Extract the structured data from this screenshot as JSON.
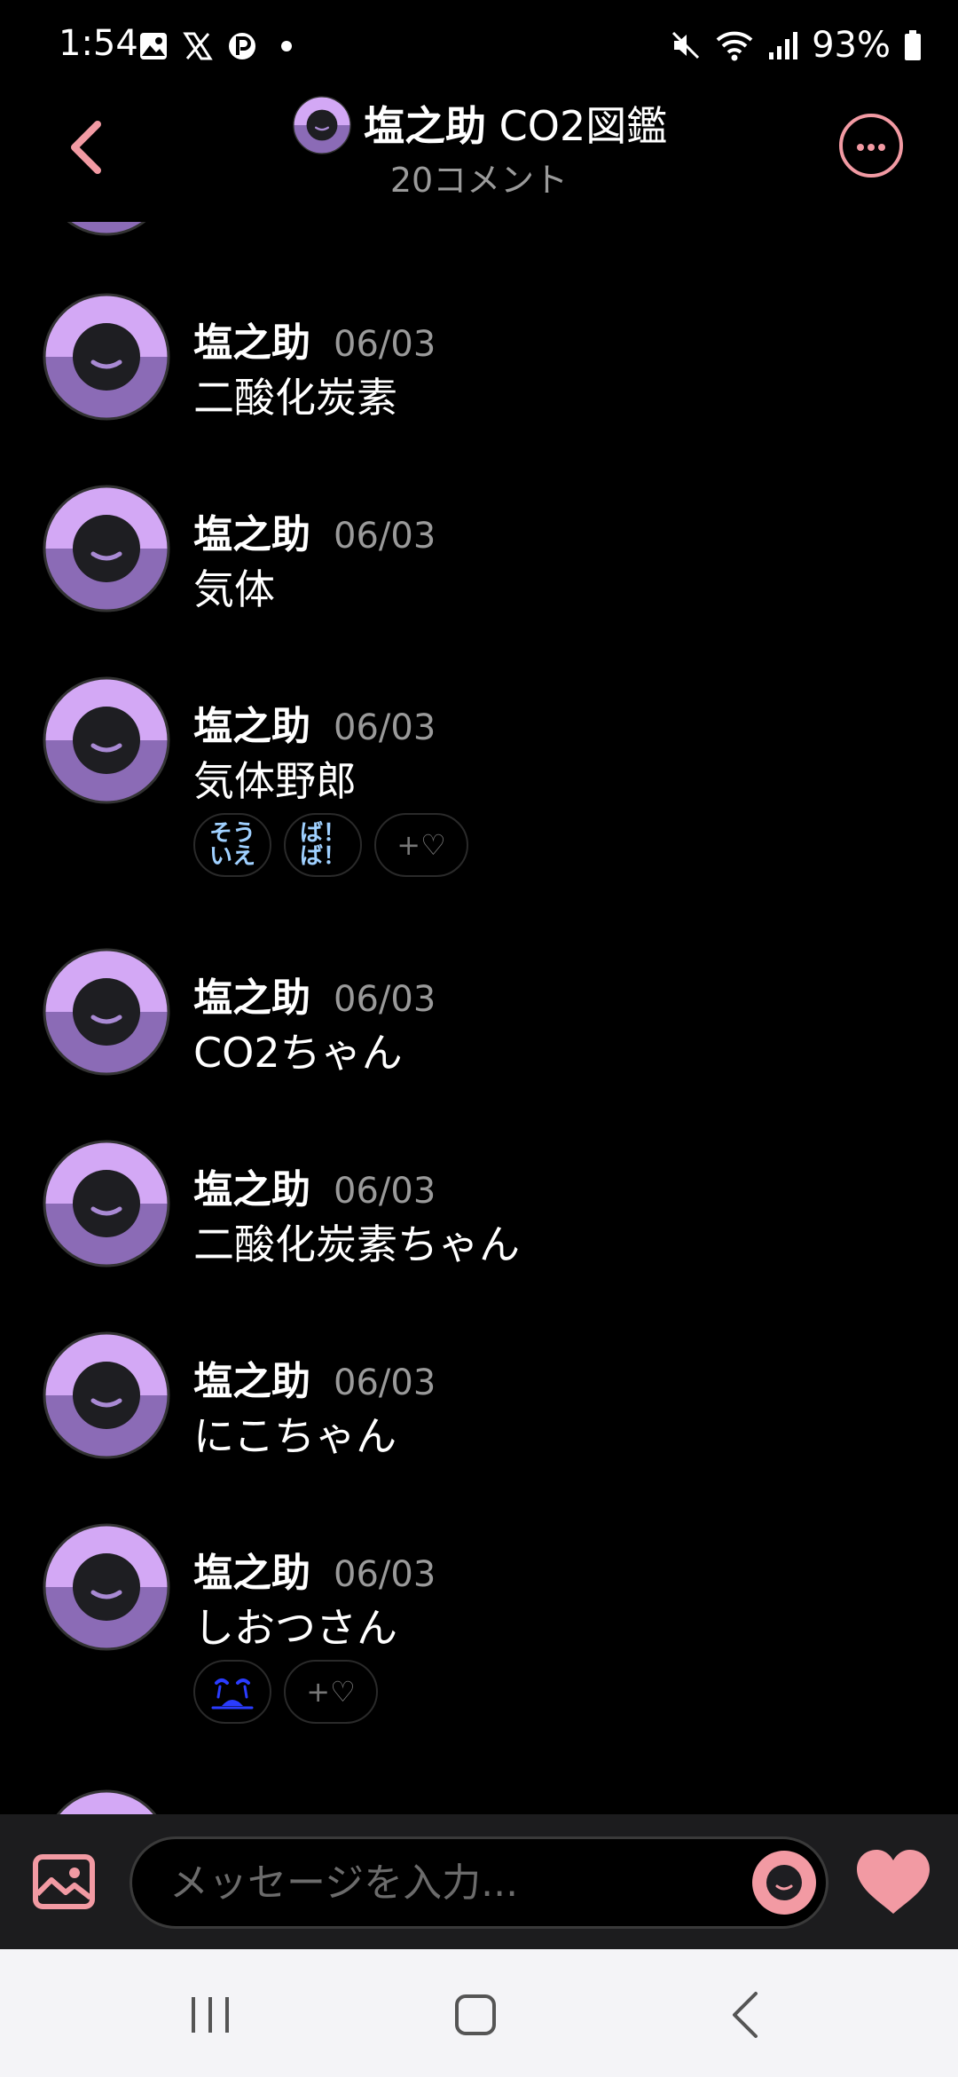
{
  "status_bar": {
    "time": "1:54",
    "battery": "93%"
  },
  "header": {
    "title_name": "塩之助",
    "title_rest": " CO2図鑑",
    "subtitle": "20コメント"
  },
  "messages": [
    {
      "name": "塩之助",
      "date": "06/03",
      "text": "二酸化炭素"
    },
    {
      "name": "塩之助",
      "date": "06/03",
      "text": "気体"
    },
    {
      "name": "塩之助",
      "date": "06/03",
      "text": "気体野郎",
      "reactions": [
        {
          "line1": "そう",
          "line2": "いえ"
        },
        {
          "line1": "ば！",
          "line2": "ば！"
        }
      ],
      "add_label": "+♡"
    },
    {
      "name": "塩之助",
      "date": "06/03",
      "text": "CO2ちゃん"
    },
    {
      "name": "塩之助",
      "date": "06/03",
      "text": "二酸化炭素ちゃん"
    },
    {
      "name": "塩之助",
      "date": "06/03",
      "text": "にこちゃん"
    },
    {
      "name": "塩之助",
      "date": "06/03",
      "text": "しおつさん",
      "add_label": "+♡"
    }
  ],
  "input": {
    "placeholder": "メッセージを入力..."
  },
  "icons": {
    "status_left": [
      "gallery-icon",
      "x-logo-icon",
      "p-icon",
      "dot-icon"
    ],
    "status_right": [
      "mute-icon",
      "wifi-icon",
      "signal-icon",
      "battery-icon"
    ],
    "header": [
      "back-chevron-icon",
      "more-icon"
    ],
    "input_bar": [
      "image-icon",
      "smile-icon",
      "heart-icon"
    ],
    "nav": [
      "recents-icon",
      "home-icon",
      "back-icon"
    ]
  },
  "colors": {
    "accent": "#f29aa3",
    "avatar_top": "#d3a8f5",
    "avatar_bottom": "#8b6bb6",
    "background": "#000000"
  }
}
